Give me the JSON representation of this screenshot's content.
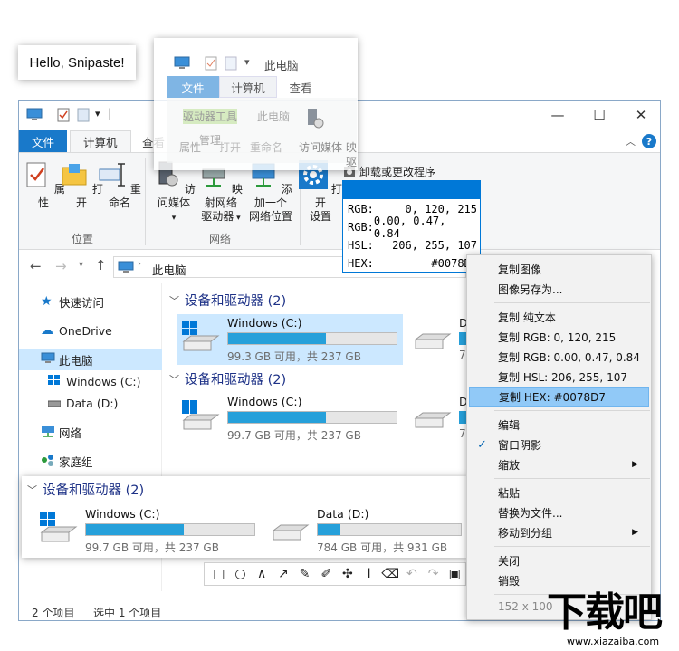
{
  "hello_snip": {
    "text": "Hello, Snipaste!"
  },
  "window": {
    "quick_access_separator": "|",
    "tabs": {
      "file": "文件",
      "computer": "计算机",
      "view": "查看"
    },
    "ribbon": {
      "properties": "属性",
      "open": "打开",
      "rename": "重命名",
      "access_media": "访问媒体",
      "map_drive_l1": "映射网络",
      "map_drive_l2": "驱动器",
      "add_location_l1": "添加一个",
      "add_location_l2": "网络位置",
      "open_settings_l1": "打开",
      "open_settings_l2": "设置",
      "uninstall": "卸载或更改程序",
      "group_location": "位置",
      "group_network": "网络"
    },
    "address": "此电脑",
    "nav": {
      "quick_access": "快速访问",
      "onedrive": "OneDrive",
      "this_pc": "此电脑",
      "windows_c": "Windows (C:)",
      "data_d": "Data (D:)",
      "network": "网络",
      "homegroup": "家庭组"
    },
    "section_title": "设备和驱动器 (2)",
    "drives_a": [
      {
        "name": "Windows (C:)",
        "info": "99.3 GB 可用，共 237 GB",
        "used_fraction": 0.58
      },
      {
        "name": "D",
        "info": "78"
      }
    ],
    "drives_b": [
      {
        "name": "Windows (C:)",
        "info": "99.7 GB 可用，共 237 GB",
        "used_fraction": 0.58
      },
      {
        "name": "D",
        "info": "78"
      }
    ],
    "status": {
      "items": "2 个项目",
      "selected": "选中 1 个项目"
    }
  },
  "snip_ribbon": {
    "address": "此电脑",
    "tabs": {
      "file": "文件",
      "computer": "计算机",
      "view": "查看"
    },
    "drive_tools": "驱动器工具",
    "this_pc": "此电脑",
    "properties": "属性",
    "manage": "管理",
    "open": "打开",
    "rename": "重命名",
    "access_media": "访问媒体",
    "map": "映",
    "map2": "驱"
  },
  "color_tip": {
    "swatch_color": "#0078D7",
    "rows": [
      {
        "label": "RGB:",
        "value": "0,  120,  215"
      },
      {
        "label": "RGB:",
        "value": "0.00, 0.47, 0.84"
      },
      {
        "label": "HSL:",
        "value": "206,  255,  107"
      },
      {
        "label": "HEX:",
        "value": "#0078D7"
      }
    ]
  },
  "snip_drives": {
    "title": "设备和驱动器 (2)",
    "drives": [
      {
        "name": "Windows (C:)",
        "info": "99.7 GB 可用，共 237 GB",
        "used_fraction": 0.58
      },
      {
        "name": "Data (D:)",
        "info": "784 GB 可用，共 931 GB",
        "used_fraction": 0.16
      }
    ]
  },
  "toolbar": {
    "tools": [
      "rectangle",
      "ellipse",
      "polyline",
      "arrow",
      "pencil",
      "marker",
      "mosaic",
      "text",
      "eraser",
      "undo",
      "redo",
      "save"
    ]
  },
  "context_menu": {
    "items": [
      {
        "label": "复制图像"
      },
      {
        "label": "图像另存为..."
      },
      {
        "label": "复制 纯文本"
      },
      {
        "label": "复制 RGB: 0, 120, 215"
      },
      {
        "label": "复制 RGB: 0.00, 0.47, 0.84"
      },
      {
        "label": "复制 HSL: 206, 255, 107"
      },
      {
        "label": "复制 HEX: #0078D7"
      },
      {
        "label": "编辑"
      },
      {
        "label": "窗口阴影"
      },
      {
        "label": "缩放"
      },
      {
        "label": "粘贴"
      },
      {
        "label": "替换为文件..."
      },
      {
        "label": "移动到分组"
      },
      {
        "label": "关闭"
      },
      {
        "label": "销毁"
      },
      {
        "label": "152 x 100"
      }
    ],
    "check_glyph": "✓",
    "submenu_glyph": "▶"
  },
  "watermark": {
    "main": "下载吧",
    "sub": "www.xiazaiba.com"
  },
  "colors": {
    "accent": "#1979CA",
    "highlight": "#91C9F7",
    "drive_fill": "#26A0DA",
    "windows_blue": "#0078D7"
  }
}
